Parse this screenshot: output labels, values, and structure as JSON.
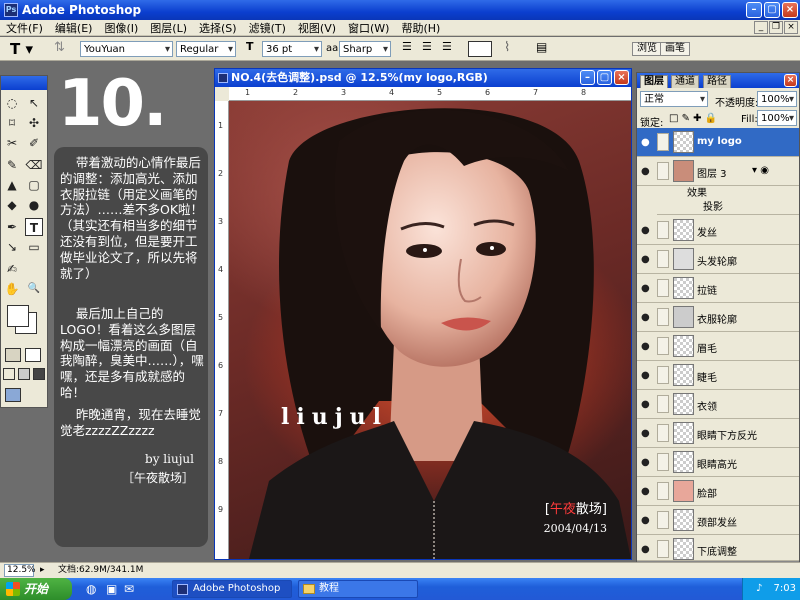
{
  "titlebar": {
    "title": "Adobe Photoshop"
  },
  "menus": [
    "文件(F)",
    "编辑(E)",
    "图像(I)",
    "图层(L)",
    "选择(S)",
    "滤镜(T)",
    "视图(V)",
    "窗口(W)",
    "帮助(H)"
  ],
  "options": {
    "font_family": "YouYuan",
    "font_style": "Regular",
    "font_size": "36 pt",
    "antialias_label": "aa",
    "antialias": "Sharp"
  },
  "palette_well": [
    "浏览",
    "画笔"
  ],
  "toolbox": {
    "tools": [
      "◌",
      "↖",
      "⌑",
      "✣",
      "✂",
      "✐",
      "✎",
      "⌫",
      "▲",
      "▢",
      "◆",
      "●",
      "✒",
      "T",
      "↘",
      "▭",
      "✍",
      "✋",
      "🔍"
    ]
  },
  "left_panel": {
    "big_number": "10.",
    "para1": "    带着激动的心情作最后的调整：添加高光、添加衣服拉链（用定义画笔的方法）……差不多OK啦！（其实还有相当多的细节还没有到位，但是要开工做毕业论文了，所以先将就了）",
    "para2": "    最后加上自己的LOGO！看着这么多图层构成一幅漂亮的画面（自我陶醉，臭美中……），嘿嘿，还是多有成就感的哈！",
    "para3": "    昨晚通宵，现在去睡觉觉老zzzzZZzzzz",
    "signature": "by liujul",
    "signature_tag": "［午夜散场］"
  },
  "document": {
    "title": "NO.4(去色调整).psd @ 12.5%(my logo,RGB)",
    "ruler_h": [
      "1",
      "2",
      "3",
      "4",
      "5",
      "6",
      "7",
      "8"
    ],
    "ruler_v": [
      "1",
      "2",
      "3",
      "4",
      "5",
      "6",
      "7",
      "8",
      "9"
    ],
    "watermark": "liujul",
    "sig_bracket_open": "[",
    "sig_red": "午夜",
    "sig_rest": "散场]",
    "sig_date": "2004/04/13"
  },
  "layers_panel": {
    "tabs": [
      "图层",
      "通道",
      "路径"
    ],
    "blend_mode": "正常",
    "opacity_label": "不透明度:",
    "opacity": "100%",
    "lock_label": "锁定:",
    "fill_label": "Fill:",
    "fill": "100%",
    "effects_label": "效果",
    "effect_item": "投影",
    "layers": [
      "my logo",
      "图层 3",
      "发丝",
      "头发轮廓",
      "拉链",
      "衣服轮廓",
      "眉毛",
      "睫毛",
      "衣领",
      "眼睛下方反光",
      "眼睛高光",
      "脸部",
      "颈部发丝",
      "下底调整"
    ]
  },
  "statusbar": {
    "zoom": "12.5%",
    "doc_info": "文档:62.9M/341.1M"
  },
  "taskbar": {
    "start": "开始",
    "tasks": [
      "Adobe Photoshop",
      "教程"
    ],
    "clock": "7:03"
  },
  "colors": {
    "titlebar": "#0b3fcf",
    "selection": "#316ac5",
    "taskbar": "#2259d6",
    "start_button": "#3a9d33",
    "logo_red": "#ff3b3b"
  }
}
